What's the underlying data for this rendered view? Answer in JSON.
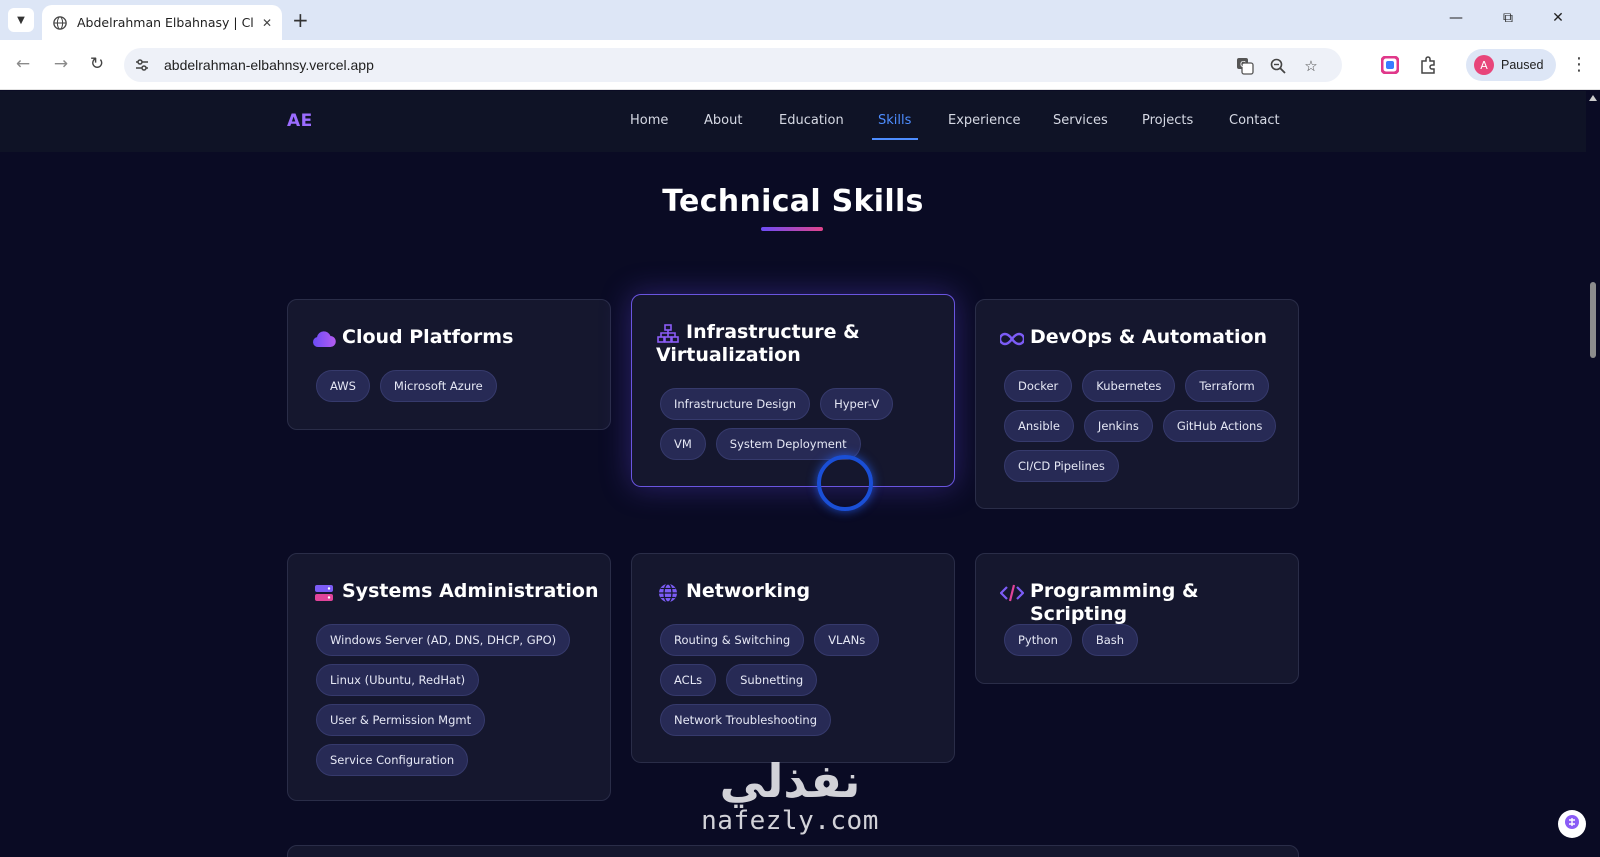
{
  "browser": {
    "tab_title": "Abdelrahman Elbahnasy | Cloud",
    "url": "abdelrahman-elbahnsy.vercel.app",
    "profile_initial": "A",
    "profile_status": "Paused"
  },
  "site": {
    "logo": "AE",
    "nav": [
      "Home",
      "About",
      "Education",
      "Skills",
      "Experience",
      "Services",
      "Projects",
      "Contact"
    ],
    "active_nav": "Skills"
  },
  "section": {
    "title": "Technical Skills"
  },
  "cards": [
    {
      "title": "Cloud Platforms",
      "icon": "cloud-icon",
      "chips": [
        "AWS",
        "Microsoft Azure"
      ]
    },
    {
      "title": "Infrastructure & Virtualization",
      "title_line1": "Infrastructure &",
      "title_line2": "Virtualization",
      "icon": "sitemap-icon",
      "chips": [
        "Infrastructure Design",
        "Hyper-V",
        "VM",
        "System Deployment"
      ]
    },
    {
      "title": "DevOps & Automation",
      "icon": "infinity-icon",
      "chips": [
        "Docker",
        "Kubernetes",
        "Terraform",
        "Ansible",
        "Jenkins",
        "GitHub Actions",
        "CI/CD Pipelines"
      ]
    },
    {
      "title": "Systems Administration",
      "icon": "server-icon",
      "chips": [
        "Windows Server (AD, DNS, DHCP, GPO)",
        "Linux (Ubuntu, RedHat)",
        "User & Permission Mgmt",
        "Service Configuration"
      ]
    },
    {
      "title": "Networking",
      "icon": "globe-icon",
      "chips": [
        "Routing & Switching",
        "VLANs",
        "ACLs",
        "Subnetting",
        "Network Troubleshooting"
      ]
    },
    {
      "title": "Programming & Scripting",
      "icon": "code-icon",
      "chips": [
        "Python",
        "Bash"
      ]
    }
  ],
  "watermark": {
    "arabic": "نفذلي",
    "latin": "nafezly.com"
  },
  "colors": {
    "accent_purple": "#9b6cff",
    "nav_active": "#4e8dff",
    "page_bg": "#0a0b24",
    "card_bg": "#15172e",
    "chip_bg": "#272a55"
  }
}
